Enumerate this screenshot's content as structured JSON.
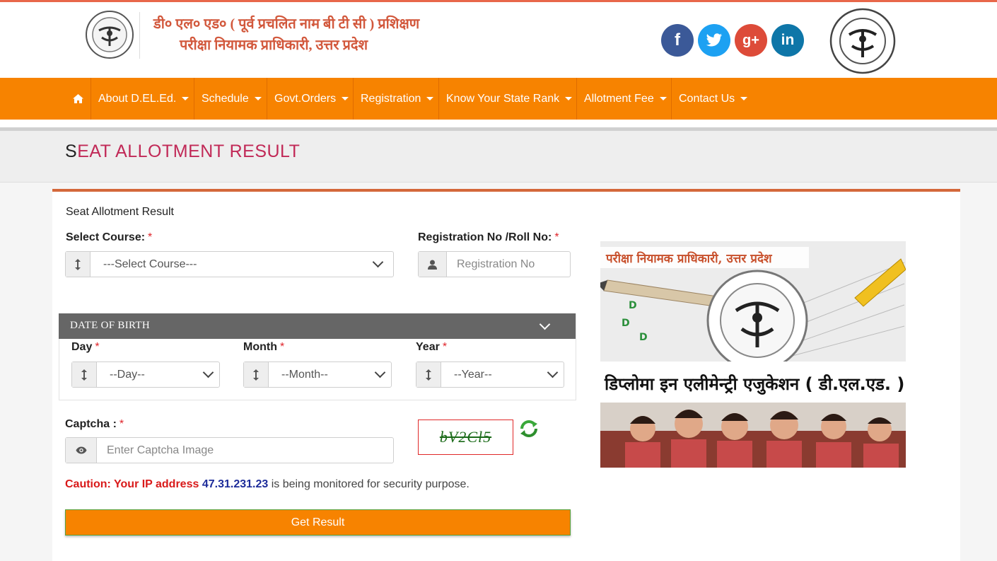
{
  "header": {
    "title_line1": "डी० एल० एड० ( पूर्व प्रचलित नाम बी टी सी ) प्रशिक्षण",
    "title_line2": "परीक्षा नियामक प्राधिकारी, उत्तर प्रदेश",
    "social": {
      "facebook": "f",
      "twitter": "t",
      "googleplus": "g+",
      "linkedin": "in"
    }
  },
  "nav": {
    "items": [
      {
        "label": "About D.EL.Ed."
      },
      {
        "label": "Schedule"
      },
      {
        "label": "Govt.Orders"
      },
      {
        "label": "Registration"
      },
      {
        "label": "Know Your State Rank"
      },
      {
        "label": "Allotment Fee"
      },
      {
        "label": "Contact Us"
      }
    ]
  },
  "page": {
    "title_first": "S",
    "title_rest": "EAT ALLOTMENT RESULT"
  },
  "form": {
    "caption": "Seat Allotment Result",
    "course": {
      "label": "Select Course:",
      "required": "*",
      "value": "---Select Course---"
    },
    "regno": {
      "label": "Registration No /Roll No:",
      "required": "*",
      "placeholder": "Registration No"
    },
    "dob": {
      "title": "DATE OF BIRTH",
      "day": {
        "label": "Day",
        "required": "*",
        "value": "--Day--"
      },
      "month": {
        "label": "Month",
        "required": "*",
        "value": "--Month--"
      },
      "year": {
        "label": "Year",
        "required": "*",
        "value": "--Year--"
      }
    },
    "captcha": {
      "label": "Captcha :",
      "required": "*",
      "placeholder": "Enter Captcha Image",
      "image_text": "bV2Cl5"
    },
    "caution": {
      "prefix": "Caution: Your IP address",
      "ip": "47.31.231.23",
      "suffix": "is being monitored for security purpose."
    },
    "submit_label": "Get Result"
  },
  "banner": {
    "top_text": "परीक्षा नियामक प्राधिकारी, उत्तर प्रदेश",
    "main_text": "डिप्लोमा इन एलीमेन्ट्री एजुकेशन ( डी.एल.एड. )"
  },
  "colors": {
    "nav_bg": "#f78300",
    "title_accent": "#c12957",
    "header_text": "#d2583c",
    "panel_top_border": "#d4683a"
  }
}
